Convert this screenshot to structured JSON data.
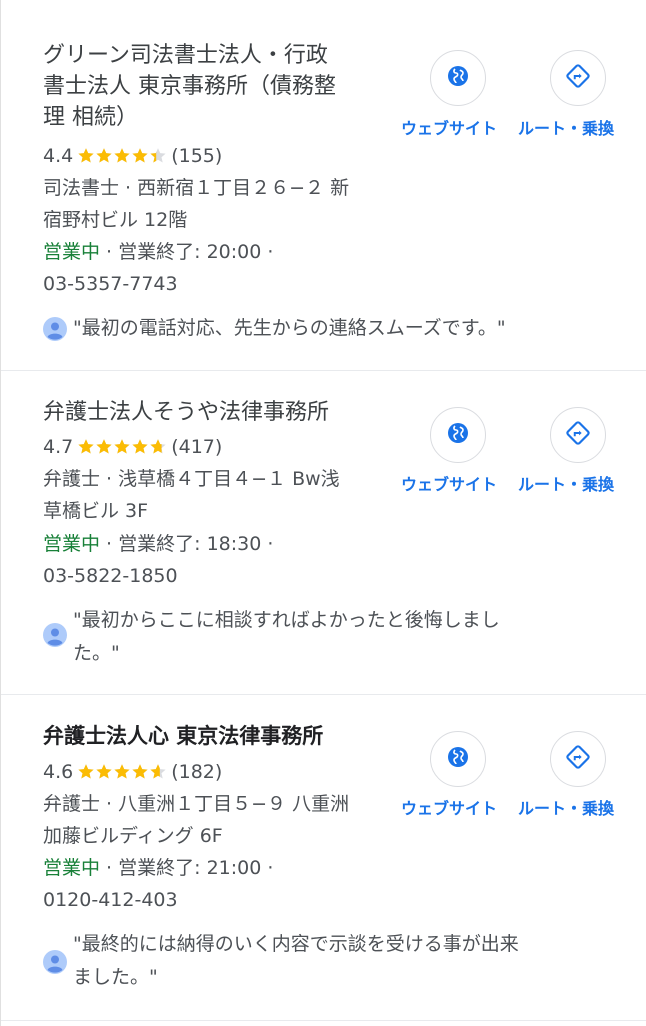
{
  "results": [
    {
      "title_lines": [
        "グリーン司法書士法人・行政",
        "書士法人 東京事務所（債務整",
        "理 相続）"
      ],
      "rating": "4.4",
      "stars": 4.4,
      "review_count": "(155)",
      "address_lines": [
        "司法書士 · 西新宿１丁目２６−２ 新",
        "宿野村ビル 12階"
      ],
      "status": "営業中",
      "hours": " · 営業終了: 20:00 ·",
      "phone": "03-5357-7743",
      "review_lines": [
        "\"最初の電話対応、先生からの連絡スムーズです。\""
      ],
      "website_label": "ウェブサイト",
      "directions_label": "ルート・乗換"
    },
    {
      "title_lines": [
        "弁護士法人そうや法律事務所"
      ],
      "rating": "4.7",
      "stars": 4.7,
      "review_count": "(417)",
      "address_lines": [
        "弁護士 · 浅草橋４丁目４−１ Bw浅",
        "草橋ビル 3F"
      ],
      "status": "営業中",
      "hours": " · 営業終了: 18:30 ·",
      "phone": "03-5822-1850",
      "review_lines": [
        "\"最初からここに相談すればよかったと後悔しまし",
        "た。\""
      ],
      "website_label": "ウェブサイト",
      "directions_label": "ルート・乗換"
    },
    {
      "title_lines": [
        "弁護士法人心 東京法律事務所"
      ],
      "rating": "4.6",
      "stars": 4.6,
      "review_count": "(182)",
      "address_lines": [
        "弁護士 · 八重洲１丁目５−９ 八重洲",
        "加藤ビルディング 6F"
      ],
      "status": "営業中",
      "hours": " · 営業終了: 21:00 ·",
      "phone": "0120-412-403",
      "review_lines": [
        "\"最終的には納得のいく内容で示談を受ける事が出来",
        "ました。\""
      ],
      "website_label": "ウェブサイト",
      "directions_label": "ルート・乗換"
    }
  ],
  "icons": {
    "website": "globe-icon",
    "directions": "directions-icon",
    "avatar": "person-avatar-icon",
    "star": "star-icon"
  },
  "colors": {
    "star": "#fbbc04",
    "star_empty": "#dadce0",
    "open": "#188038",
    "link": "#1a73e8"
  }
}
